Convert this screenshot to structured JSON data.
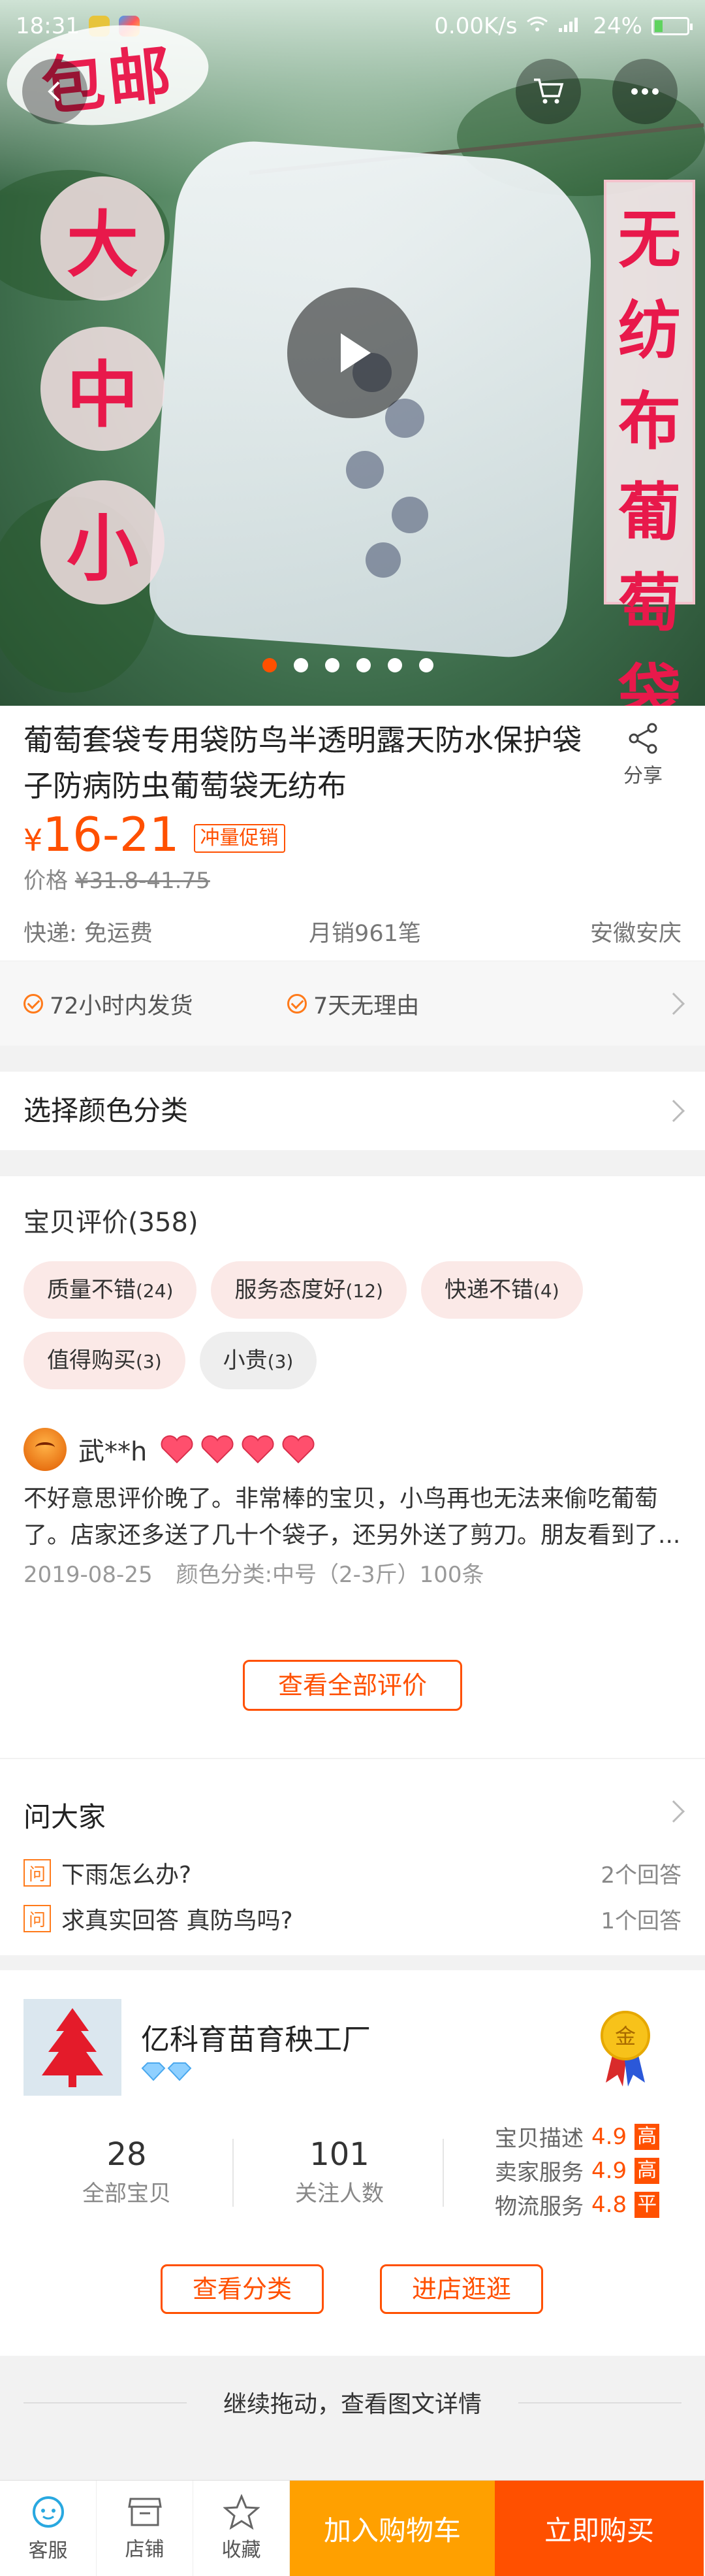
{
  "status_bar": {
    "time": "18:31",
    "network_speed": "0.00K/s",
    "battery": "24%"
  },
  "hero": {
    "logo_text": "包邮",
    "size_labels": [
      "大",
      "中",
      "小"
    ],
    "banner_chars": [
      "无",
      "纺",
      "布",
      "葡",
      "萄",
      "袋"
    ],
    "slide_count": 6,
    "active_slide": 1
  },
  "product": {
    "title": "葡萄套袋专用袋防鸟半透明露天防水保护袋子防病防虫葡萄袋无纺布",
    "share_label": "分享",
    "price_symbol": "¥",
    "price": "16-21",
    "promo_tag": "冲量促销",
    "original_label": "价格",
    "original_price": "¥31.8-41.75",
    "shipping": "快递: 免运费",
    "monthly_sales": "月销961笔",
    "location": "安徽安庆"
  },
  "services": [
    "72小时内发货",
    "7天无理由"
  ],
  "color_select": {
    "label": "选择颜色分类"
  },
  "reviews": {
    "title": "宝贝评价(358)",
    "tags": [
      {
        "label": "质量不错",
        "count": "(24)"
      },
      {
        "label": "服务态度好",
        "count": "(12)"
      },
      {
        "label": "快递不错",
        "count": "(4)"
      },
      {
        "label": "值得购买",
        "count": "(3)"
      },
      {
        "label": "小贵",
        "count": "(3)"
      }
    ],
    "reviewer": "武**h",
    "text": "不好意思评价晚了。非常棒的宝贝，小鸟再也无法来偷吃葡萄了。店家还多送了几十个袋子，还另外送了剪刀。朋友看到了...",
    "date": "2019-08-25",
    "variant": "颜色分类:中号（2-3斤）100条",
    "view_all": "查看全部评价"
  },
  "ask": {
    "title": "问大家",
    "badge": "问",
    "questions": [
      {
        "q": "下雨怎么办?",
        "answers": "2个回答"
      },
      {
        "q": "求真实回答 真防鸟吗?",
        "answers": "1个回答"
      }
    ]
  },
  "shop": {
    "name": "亿科育苗育秧工厂",
    "badge_char": "金",
    "stats": [
      {
        "value": "28",
        "label": "全部宝贝"
      },
      {
        "value": "101",
        "label": "关注人数"
      }
    ],
    "scores": [
      {
        "label": "宝贝描述",
        "value": "4.9",
        "level": "高"
      },
      {
        "label": "卖家服务",
        "value": "4.9",
        "level": "高"
      },
      {
        "label": "物流服务",
        "value": "4.8",
        "level": "平"
      }
    ],
    "btn_category": "查看分类",
    "btn_visit": "进店逛逛"
  },
  "drag_hint": "继续拖动，查看图文详情",
  "bottom_bar": {
    "service": "客服",
    "store": "店铺",
    "favorite": "收藏",
    "add_cart": "加入购物车",
    "buy_now": "立即购买"
  },
  "colors": {
    "accent": "#ff5000",
    "cart": "#ffa000",
    "logo_red": "#e8194b"
  }
}
